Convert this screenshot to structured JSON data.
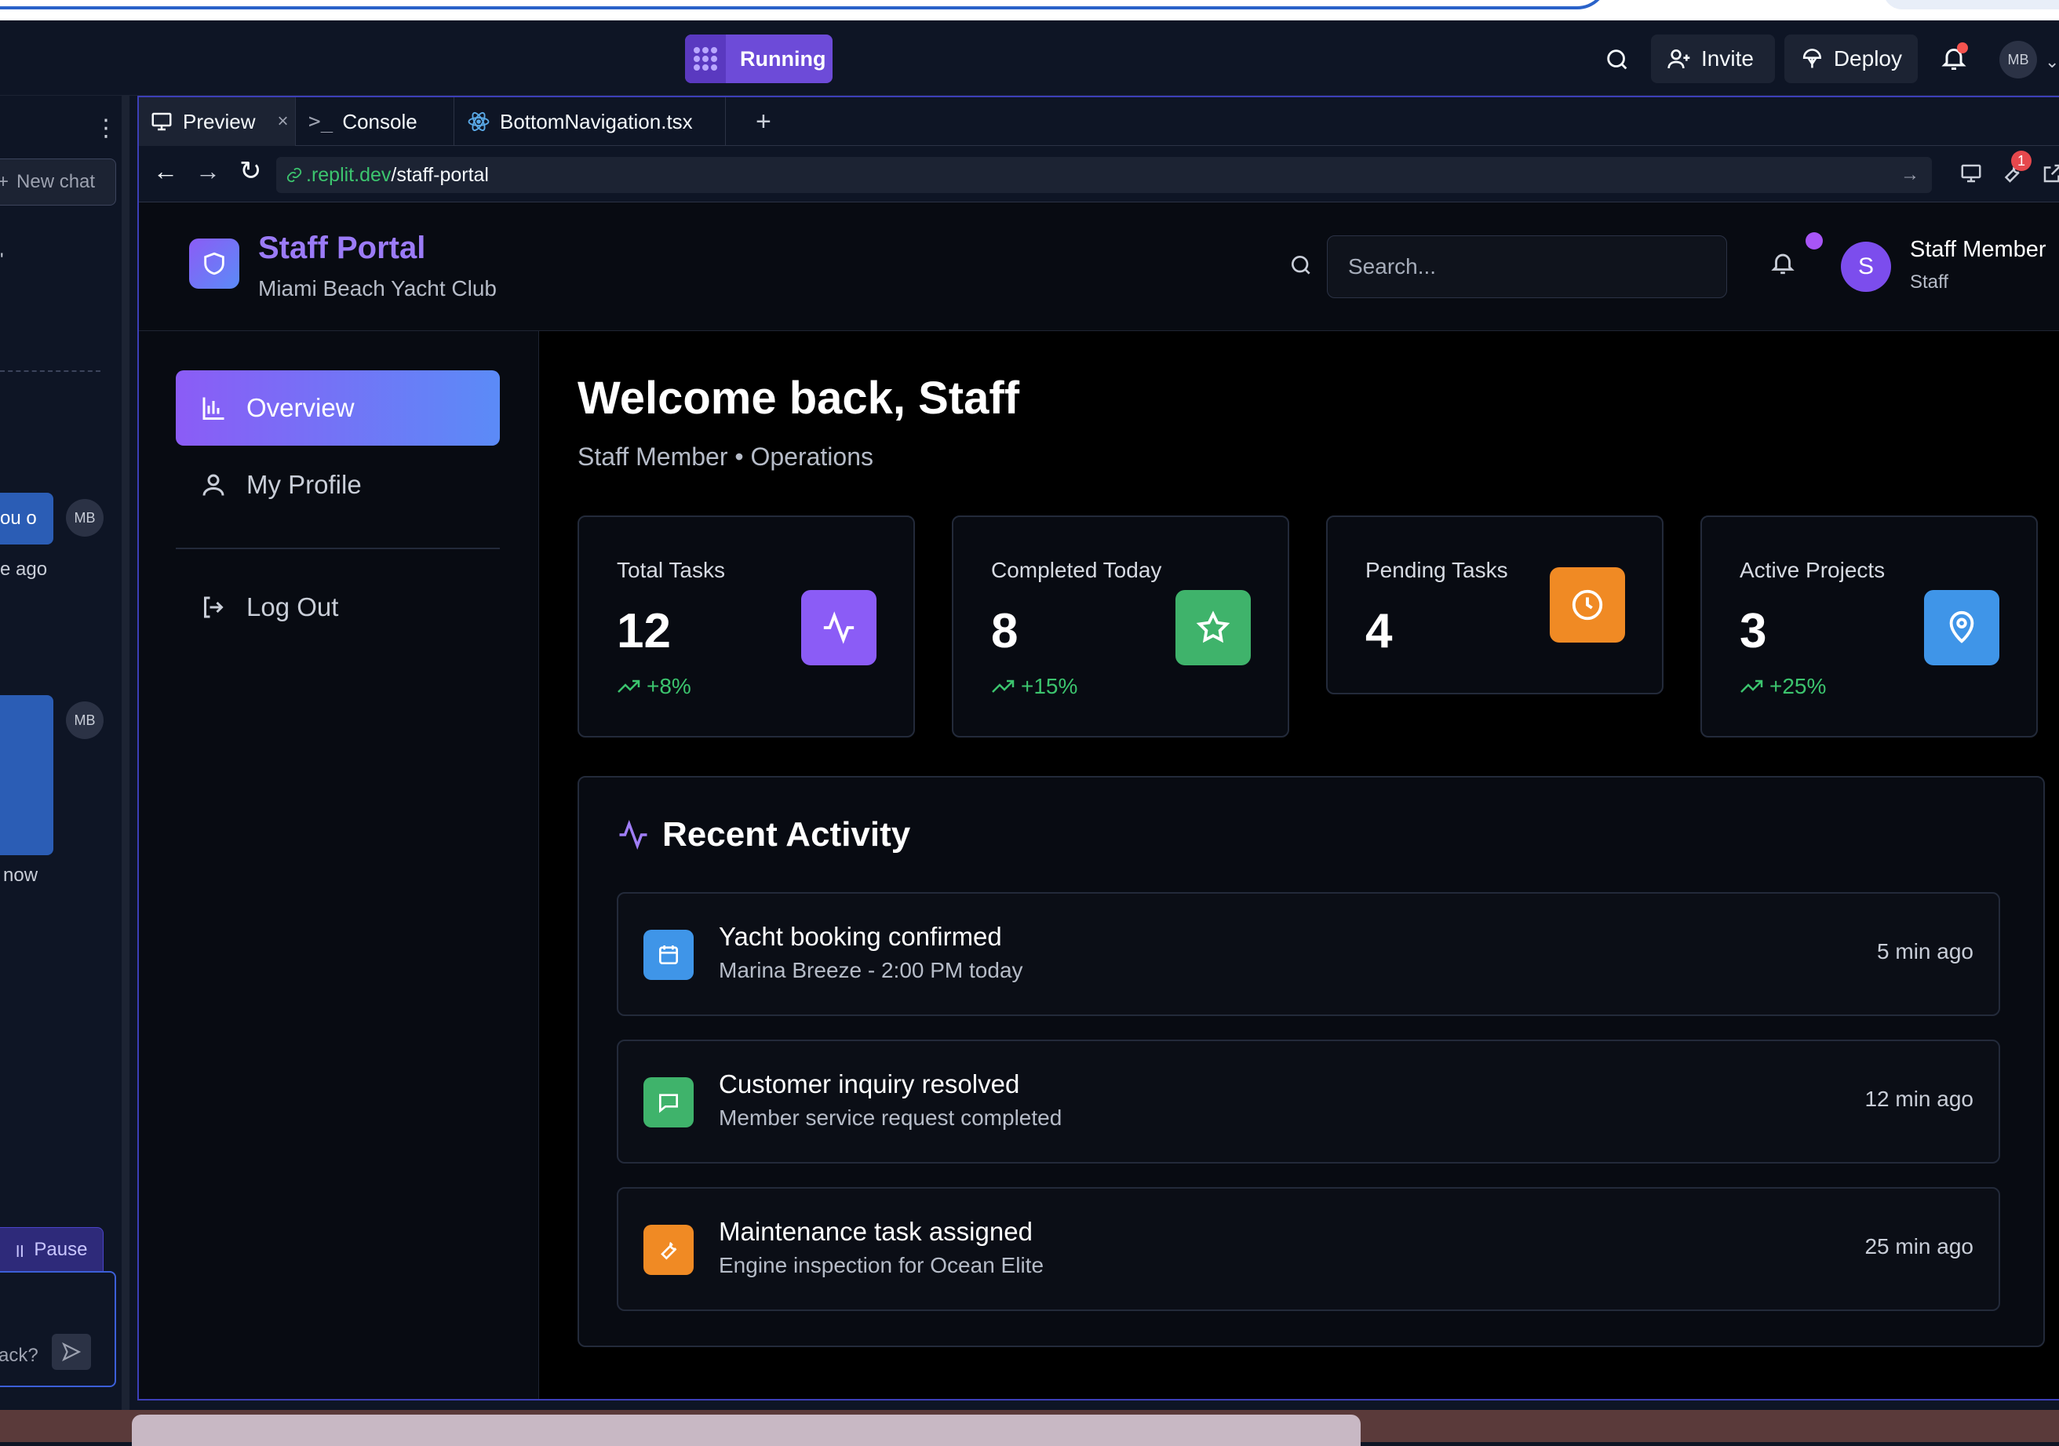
{
  "top_bar": {
    "run_label": "Running",
    "invite_label": "Invite",
    "deploy_label": "Deploy",
    "user_initials": "MB"
  },
  "left_panel": {
    "new_chat": "New chat",
    "msg_fragment_1": "ou o",
    "msg_time_1": "e ago",
    "avatar_initials_1": "MB",
    "avatar_initials_2": "MB",
    "msg_time_2": "now",
    "pause_label": "Pause",
    "input_fragment": "ack?"
  },
  "tabs": [
    {
      "label": "Preview"
    },
    {
      "label": "Console"
    },
    {
      "label": "BottomNavigation.tsx"
    }
  ],
  "url": {
    "domain": ".replit.dev",
    "path": "/staff-portal",
    "devtools_badge": "1"
  },
  "app": {
    "title": "Staff Portal",
    "subtitle": "Miami Beach Yacht Club",
    "search_placeholder": "Search...",
    "avatar_letter": "S",
    "user_name": "Staff Member",
    "user_role": "Staff"
  },
  "sidebar": {
    "items": [
      {
        "label": "Overview",
        "icon": "bar-chart-icon"
      },
      {
        "label": "My Profile",
        "icon": "user-icon"
      },
      {
        "label": "Log Out",
        "icon": "logout-icon"
      }
    ]
  },
  "main": {
    "welcome": "Welcome back, Staff",
    "welcome_sub": "Staff Member • Operations",
    "stats": [
      {
        "label": "Total Tasks",
        "value": "12",
        "trend": "+8%",
        "icon": "activity-icon",
        "color": "#8b5cf6"
      },
      {
        "label": "Completed Today",
        "value": "8",
        "trend": "+15%",
        "icon": "star-icon",
        "color": "#3fb36b"
      },
      {
        "label": "Pending Tasks",
        "value": "4",
        "trend": "",
        "icon": "clock-icon",
        "color": "#f08a24"
      },
      {
        "label": "Active Projects",
        "value": "3",
        "trend": "+25%",
        "icon": "map-pin-icon",
        "color": "#3f95e8"
      }
    ],
    "activity_title": "Recent Activity",
    "activity": [
      {
        "title": "Yacht booking confirmed",
        "sub": "Marina Breeze - 2:00 PM today",
        "time": "5 min ago",
        "icon": "calendar-icon",
        "color": "#3f95e8"
      },
      {
        "title": "Customer inquiry resolved",
        "sub": "Member service request completed",
        "time": "12 min ago",
        "icon": "message-icon",
        "color": "#3fb36b"
      },
      {
        "title": "Maintenance task assigned",
        "sub": "Engine inspection for Ocean Elite",
        "time": "25 min ago",
        "icon": "wrench-icon",
        "color": "#f08a24"
      }
    ]
  }
}
